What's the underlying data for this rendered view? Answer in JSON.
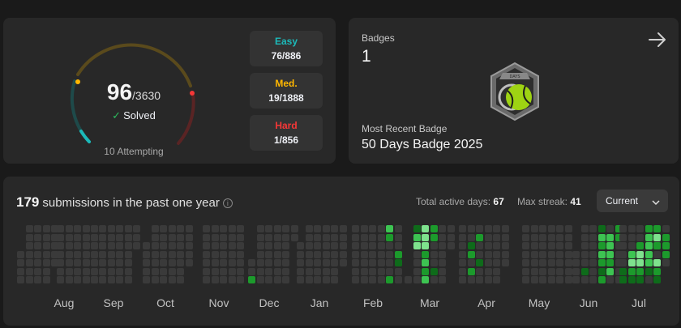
{
  "progress": {
    "solved": "96",
    "total": "/3630",
    "solved_label": "Solved",
    "attempting": "10 Attempting"
  },
  "difficulty": {
    "easy": {
      "label": "Easy",
      "value": "76/886",
      "color": "#1cbaba"
    },
    "medium": {
      "label": "Med.",
      "value": "19/1888",
      "color": "#ffb700"
    },
    "hard": {
      "label": "Hard",
      "value": "1/856",
      "color": "#f63737"
    }
  },
  "badges": {
    "title": "Badges",
    "count": "1",
    "recent_label": "Most Recent Badge",
    "recent_name": "50 Days Badge 2025",
    "badge_icon": "50-days-badge-icon",
    "badge_text": "DAYS"
  },
  "heatmap": {
    "count": "179",
    "caption": "submissions in the past one year",
    "active_label": "Total active days:",
    "active_value": "67",
    "streak_label": "Max streak:",
    "streak_value": "41",
    "dropdown_value": "Current",
    "months": [
      "Aug",
      "Sep",
      "Oct",
      "Nov",
      "Dec",
      "Jan",
      "Feb",
      "Mar",
      "Apr",
      "May",
      "Jun",
      "Jul"
    ],
    "colors": {
      "empty": "#3a3a3a",
      "low": "#0e6b1a",
      "mid": "#1c9a2c",
      "high": "#3dc452",
      "max": "#7ee28d"
    }
  }
}
